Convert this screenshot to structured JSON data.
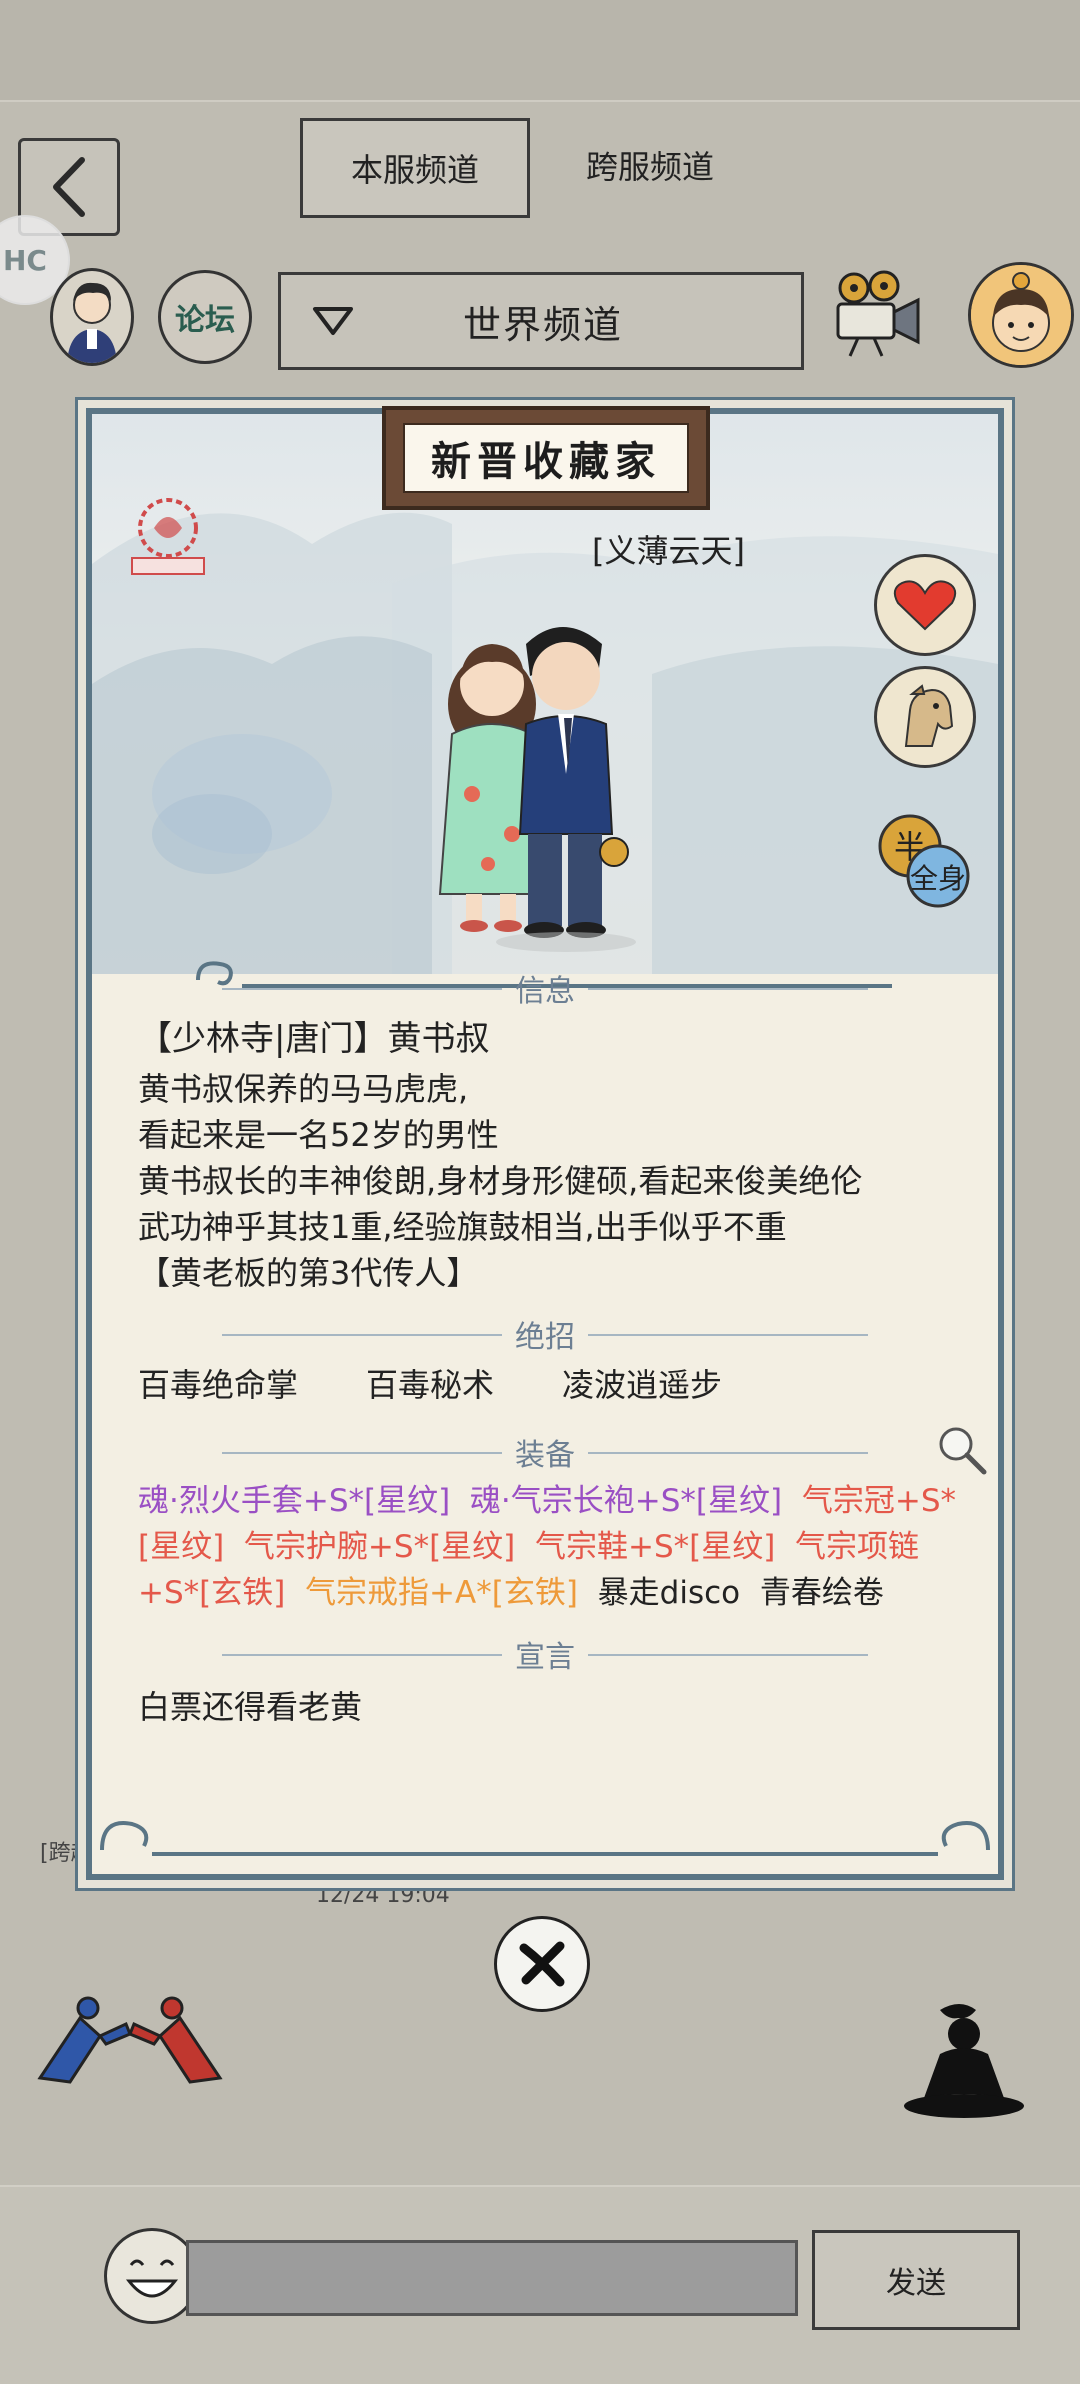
{
  "header": {
    "tabs": [
      {
        "label": "本服频道",
        "active": true
      },
      {
        "label": "跨服频道",
        "active": false
      }
    ],
    "forum_label": "论坛",
    "channel_selector": "世界频道"
  },
  "background": {
    "message_sender": "[跨越",
    "message_time": "12/24 19:04"
  },
  "profile_card": {
    "title": "新晋收藏家",
    "player_name": "[义薄云天]",
    "side_buttons": [
      "heart-icon",
      "horse-icon",
      "半全身"
    ],
    "info_header": "信息",
    "identity": "【少林寺|唐门】黄书叔",
    "info_lines": [
      "黄书叔保养的马马虎虎,",
      "看起来是一名52岁的男性",
      "黄书叔长的丰神俊朗,身材身形健硕,看起来俊美绝伦",
      "武功神乎其技1重,经验旗鼓相当,出手似乎不重",
      "【黄老板的第3代传人】"
    ],
    "skills_header": "绝招",
    "skills": [
      "百毒绝命掌",
      "百毒秘术",
      "凌波逍遥步"
    ],
    "equip_header": "装备",
    "equipment": [
      {
        "text": "魂·烈火手套+S*[星纹]",
        "color": "#9a4fc4"
      },
      {
        "text": "魂·气宗长袍+S*[星纹]",
        "color": "#9a4fc4"
      },
      {
        "text": "气宗冠+S*[星纹]",
        "color": "#e4584a"
      },
      {
        "text": "气宗护腕+S*[星纹]",
        "color": "#e4584a"
      },
      {
        "text": "气宗鞋+S*[星纹]",
        "color": "#e4584a"
      },
      {
        "text": "气宗项链+S*[玄铁]",
        "color": "#e4584a"
      },
      {
        "text": "气宗戒指+A*[玄铁]",
        "color": "#ee9a3a"
      },
      {
        "text": "暴走disco",
        "color": "#222222"
      },
      {
        "text": "青春绘卷",
        "color": "#222222"
      }
    ],
    "declaration_header": "宣言",
    "declaration": "白票还得看老黄"
  },
  "footer": {
    "send_label": "发送",
    "input_placeholder": ""
  },
  "colors": {
    "page_bg": "#bfbcb2",
    "card_border": "#5a7585",
    "section_header": "#6c7f93"
  }
}
